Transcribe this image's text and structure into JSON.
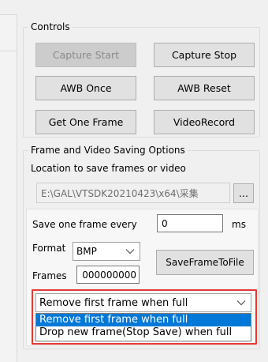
{
  "controls": {
    "title": "Controls",
    "capture_start": "Capture Start",
    "capture_stop": "Capture Stop",
    "awb_once": "AWB Once",
    "awb_reset": "AWB Reset",
    "get_one_frame": "Get One Frame",
    "video_record": "VideoRecord"
  },
  "saving": {
    "title": "Frame and Video Saving Options",
    "location_label": "Location to save frames or video",
    "path_value": "E:\\GAL\\VTSDK20210423\\x64\\采集",
    "browse_label": "...",
    "save_every_label": "Save one frame every",
    "save_every_value": "0",
    "save_every_unit": "ms",
    "format_label": "Format",
    "format_value": "BMP",
    "frames_label": "Frames",
    "frames_value": "000000000",
    "save_frame_button": "SaveFrameToFile",
    "full_mode_value": "Remove first frame when full",
    "full_mode_options": [
      "Remove first frame when full",
      "Drop new frame(Stop Save) when full"
    ]
  },
  "colors": {
    "selection": "#0078d7",
    "highlight": "#e53935"
  },
  "icons": {
    "dropdown": "chevron-down-icon"
  }
}
